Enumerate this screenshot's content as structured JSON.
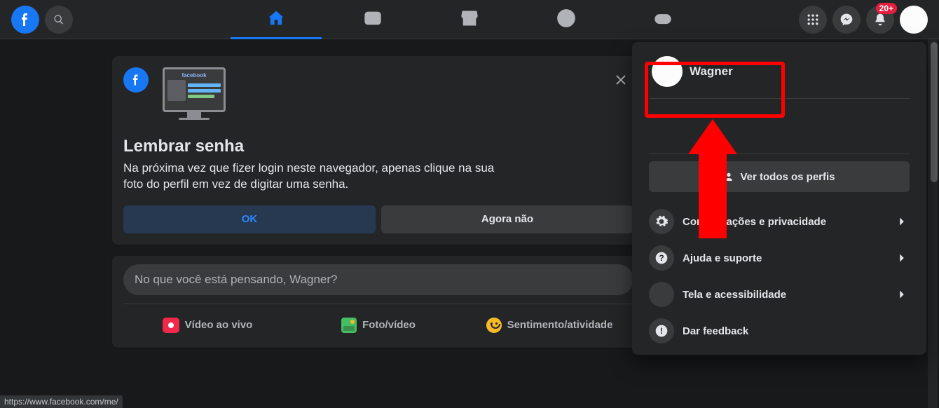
{
  "topbar": {
    "notifications_badge": "20+"
  },
  "remember": {
    "illu_word": "facebook",
    "title": "Lembrar senha",
    "body": "Na próxima vez que fizer login neste navegador, apenas clique na sua foto do perfil em vez de digitar uma senha.",
    "ok": "OK",
    "not_now": "Agora não"
  },
  "composer": {
    "placeholder": "No que você está pensando, Wagner?",
    "live": "Vídeo ao vivo",
    "photo": "Foto/vídeo",
    "feeling": "Sentimento/atividade"
  },
  "dropdown": {
    "profile_name": "Wagner",
    "see_all": "Ver todos os perfis",
    "items": [
      "Configurações e privacidade",
      "Ajuda e suporte",
      "Tela e acessibilidade",
      "Dar feedback"
    ]
  },
  "status_url": "https://www.facebook.com/me/"
}
